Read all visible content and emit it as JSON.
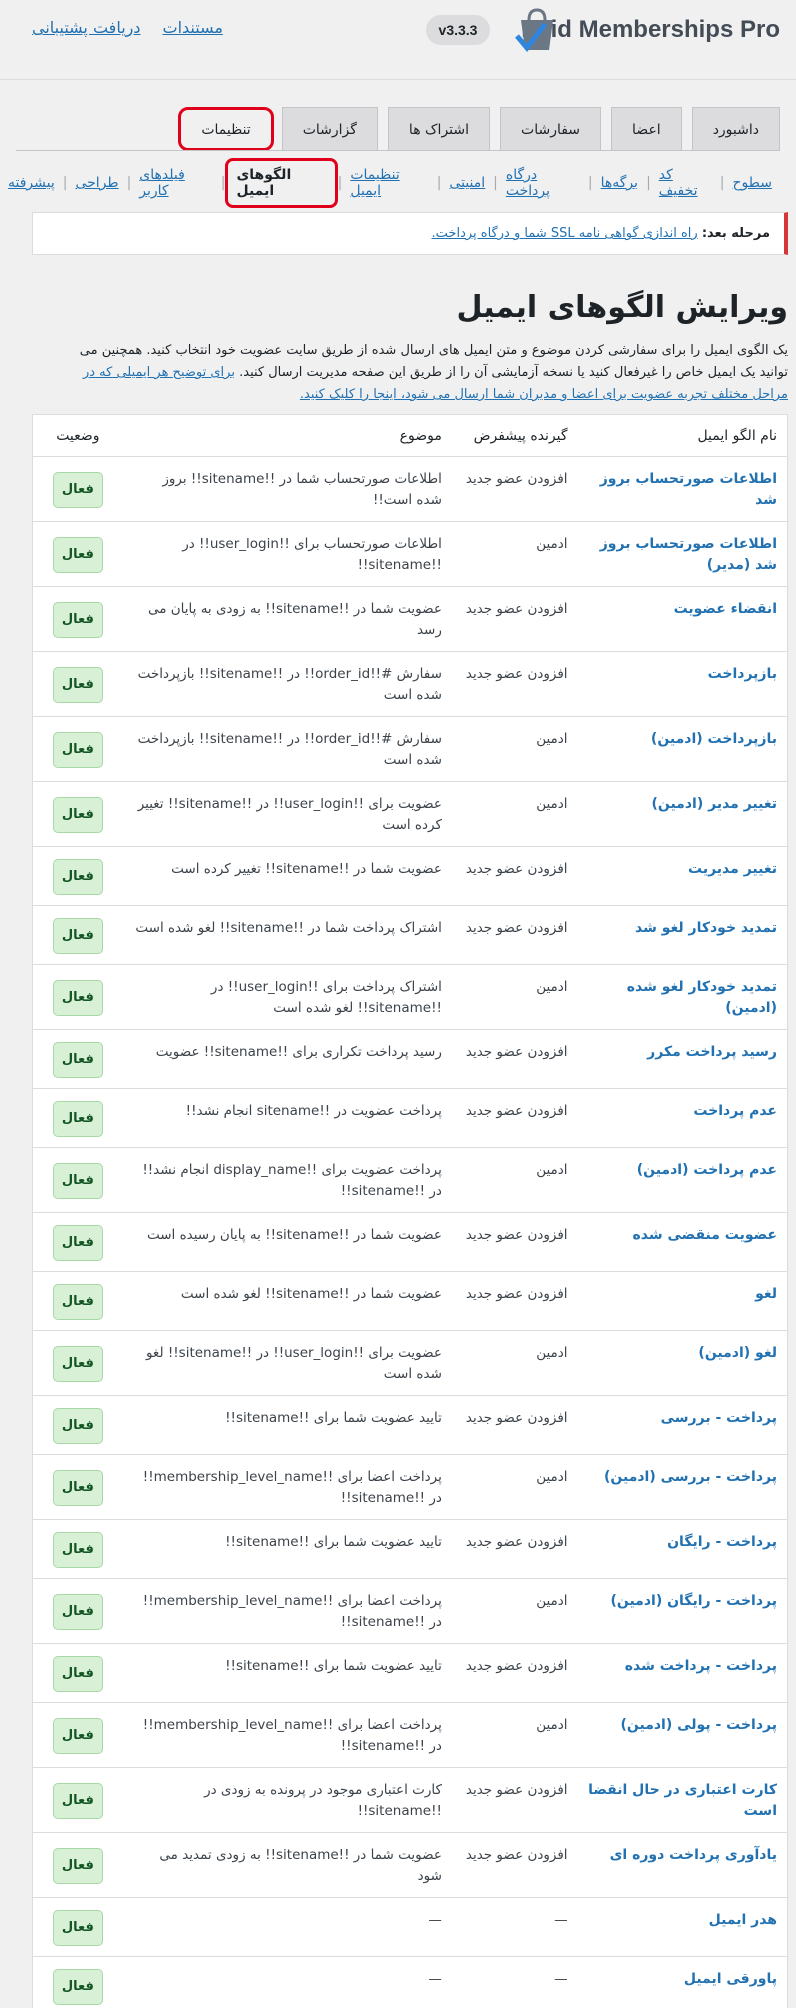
{
  "header": {
    "brand": "Paid Memberships Pro",
    "version": "v3.3.3",
    "links": [
      "مستندات",
      "دریافت پشتیبانی"
    ]
  },
  "tabs": [
    "داشبورد",
    "اعضا",
    "سفارشات",
    "اشتراک ها",
    "گزارشات",
    "تنظیمات"
  ],
  "active_tab": "تنظیمات",
  "subnav": [
    "سطوح",
    "کد تخفیف",
    "برگه‌ها",
    "درگاه پرداخت",
    "امنیتی",
    "تنظیمات ایمیل",
    "الگوهای ایمیل",
    "فیلدهای کاربر",
    "طراحی",
    "پیشرفته"
  ],
  "active_subnav": "الگوهای ایمیل",
  "notice": {
    "label": "مرحله بعد:",
    "link": "راه اندازی گواهی نامه SSL شما و درگاه پرداخت."
  },
  "page_title": "ویرایش الگوهای ایمیل",
  "intro": {
    "text": "یک الگوی ایمیل را برای سفارشی کردن موضوع و متن ایمیل های ارسال شده از طریق سایت عضویت خود انتخاب کنید. همچنین می توانید یک ایمیل خاص را غیرفعال کنید یا نسخه آزمایشی آن را از طریق این صفحه مدیریت ارسال کنید.",
    "link": "برای توضیح هر ایمیلی که در مراحل مختلف تجربه عضویت برای اعضا و مدیران شما ارسال می شود، اینجا را کلیک کنید."
  },
  "table": {
    "headers": {
      "name": "نام الگو ایمیل",
      "recipient": "گیرنده پیشفرض",
      "subject": "موضوع",
      "status": "وضعیت"
    },
    "rows": [
      {
        "name": "اطلاعات صورتحساب بروز شد",
        "recipient": "افزودن عضو جدید",
        "subject": "اطلاعات صورتحساب شما در !!sitename!! بروز شده است!!",
        "status": "فعال"
      },
      {
        "name": "اطلاعات صورتحساب بروز شد (مدیر)",
        "recipient": "ادمین",
        "subject": "اطلاعات صورتحساب برای !!user_login!! در !!sitename!!",
        "status": "فعال"
      },
      {
        "name": "انقضاء عضویت",
        "recipient": "افزودن عضو جدید",
        "subject": "عضویت شما در !!sitename!! به زودی به پایان می رسد",
        "status": "فعال"
      },
      {
        "name": "بازپرداخت",
        "recipient": "افزودن عضو جدید",
        "subject": "سفارش #!!order_id!! در !!sitename!! بازپرداخت شده است",
        "status": "فعال"
      },
      {
        "name": "بازپرداخت (ادمین)",
        "recipient": "ادمین",
        "subject": "سفارش #!!order_id!! در !!sitename!! بازپرداخت شده است",
        "status": "فعال"
      },
      {
        "name": "تغییر مدیر (ادمین)",
        "recipient": "ادمین",
        "subject": "عضویت برای !!user_login!! در !!sitename!! تغییر کرده است",
        "status": "فعال"
      },
      {
        "name": "تغییر مدیریت",
        "recipient": "افزودن عضو جدید",
        "subject": "عضویت شما در !!sitename!! تغییر کرده است",
        "status": "فعال"
      },
      {
        "name": "تمدید خودکار لغو شد",
        "recipient": "افزودن عضو جدید",
        "subject": "اشتراک پرداخت شما در !!sitename!! لغو شده است",
        "status": "فعال"
      },
      {
        "name": "تمدید خودکار لغو شده (ادمین)",
        "recipient": "ادمین",
        "subject": "اشتراک پرداخت برای !!user_login!! در !!sitename!! لغو شده است",
        "status": "فعال"
      },
      {
        "name": "رسید پرداخت مکرر",
        "recipient": "افزودن عضو جدید",
        "subject": "رسید پرداخت تکراری برای !!sitename!! عضویت",
        "status": "فعال"
      },
      {
        "name": "عدم پرداخت",
        "recipient": "افزودن عضو جدید",
        "subject": "پرداخت عضویت در !!sitename انجام نشد!!",
        "status": "فعال"
      },
      {
        "name": "عدم پرداخت (ادمین)",
        "recipient": "ادمین",
        "subject": "پرداخت عضویت برای !!display_name انجام نشد!! در !!sitename!!",
        "status": "فعال"
      },
      {
        "name": "عضویت منقضی شده",
        "recipient": "افزودن عضو جدید",
        "subject": "عضویت شما در !!sitename!! به پایان رسیده است",
        "status": "فعال"
      },
      {
        "name": "لغو",
        "recipient": "افزودن عضو جدید",
        "subject": "عضویت شما در !!sitename!! لغو شده است",
        "status": "فعال"
      },
      {
        "name": "لغو (ادمین)",
        "recipient": "ادمین",
        "subject": "عضویت برای !!user_login!! در !!sitename!! لغو شده است",
        "status": "فعال"
      },
      {
        "name": "پرداخت - بررسی",
        "recipient": "افزودن عضو جدید",
        "subject": "تایید عضویت شما برای !!sitename!!",
        "status": "فعال"
      },
      {
        "name": "پرداخت - بررسی (ادمین)",
        "recipient": "ادمین",
        "subject": "پرداخت اعضا برای !!membership_level_name!! در !!sitename!!",
        "status": "فعال"
      },
      {
        "name": "پرداخت - رایگان",
        "recipient": "افزودن عضو جدید",
        "subject": "تایید عضویت شما برای !!sitename!!",
        "status": "فعال"
      },
      {
        "name": "پرداخت - رایگان (ادمین)",
        "recipient": "ادمین",
        "subject": "پرداخت اعضا برای !!membership_level_name!! در !!sitename!!",
        "status": "فعال"
      },
      {
        "name": "پرداخت - پرداخت شده",
        "recipient": "افزودن عضو جدید",
        "subject": "تایید عضویت شما برای !!sitename!!",
        "status": "فعال"
      },
      {
        "name": "پرداخت - پولی (ادمین)",
        "recipient": "ادمین",
        "subject": "پرداخت اعضا برای !!membership_level_name!! در !!sitename!!",
        "status": "فعال"
      },
      {
        "name": "کارت اعتباری در حال انقضا است",
        "recipient": "افزودن عضو جدید",
        "subject": "کارت اعتباری موجود در پرونده به زودی در !!sitename!!",
        "status": "فعال"
      },
      {
        "name": "یادآوری پرداخت دوره ای",
        "recipient": "افزودن عضو جدید",
        "subject": "عضویت شما در !!sitename!! به زودی تمدید می شود",
        "status": "فعال"
      },
      {
        "name": "هدر ایمیل",
        "recipient": "—",
        "subject": "—",
        "status": "فعال"
      },
      {
        "name": "پاورقی ایمیل",
        "recipient": "—",
        "subject": "—",
        "status": "فعال"
      }
    ]
  },
  "colors": {
    "link": "#2271b1",
    "highlight": "#e0001b",
    "badge_bg": "#d7f0d6",
    "badge_text": "#155724"
  }
}
